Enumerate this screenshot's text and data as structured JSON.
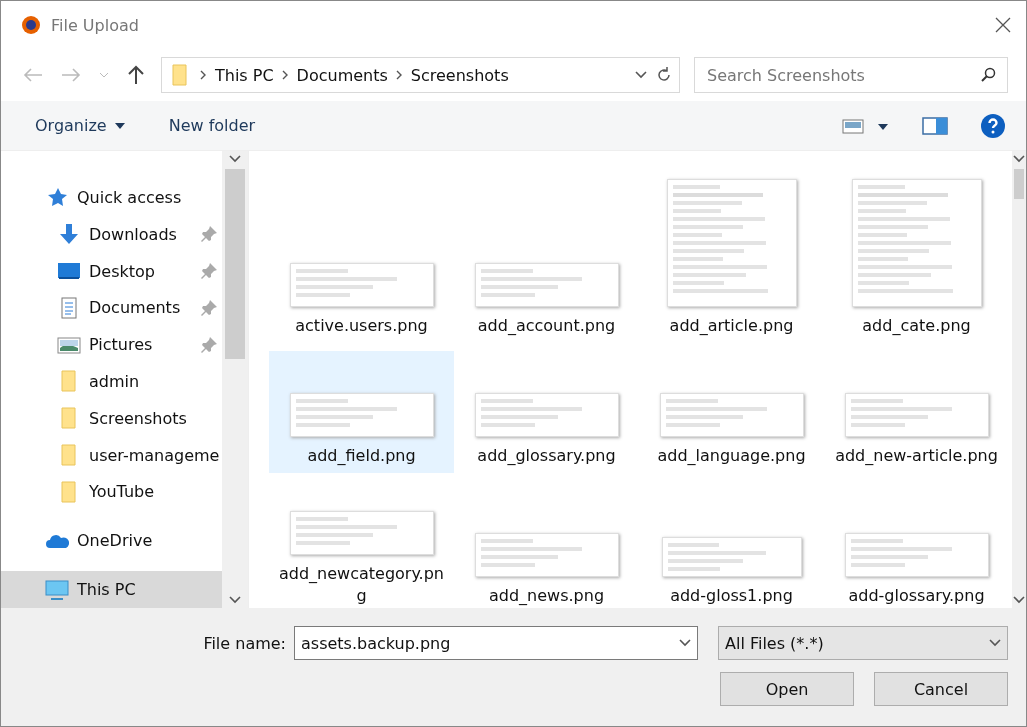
{
  "window": {
    "title": "File Upload"
  },
  "address": {
    "path": [
      "This PC",
      "Documents",
      "Screenshots"
    ],
    "search_placeholder": "Search Screenshots"
  },
  "toolbar": {
    "organize": "Organize",
    "new_folder": "New folder"
  },
  "sidebar": {
    "items": [
      {
        "kind": "header",
        "label": "Quick access",
        "pinned": false,
        "selected": false
      },
      {
        "kind": "item",
        "label": "Downloads",
        "pinned": true,
        "selected": false
      },
      {
        "kind": "item",
        "label": "Desktop",
        "pinned": true,
        "selected": false
      },
      {
        "kind": "item",
        "label": "Documents",
        "pinned": true,
        "selected": false
      },
      {
        "kind": "item",
        "label": "Pictures",
        "pinned": true,
        "selected": false
      },
      {
        "kind": "item",
        "label": "admin",
        "pinned": false,
        "selected": false
      },
      {
        "kind": "item",
        "label": "Screenshots",
        "pinned": false,
        "selected": false
      },
      {
        "kind": "item",
        "label": "user-manageme",
        "pinned": false,
        "selected": false
      },
      {
        "kind": "item",
        "label": "YouTube",
        "pinned": false,
        "selected": false
      },
      {
        "kind": "header",
        "label": "OneDrive",
        "pinned": false,
        "selected": false
      },
      {
        "kind": "header",
        "label": "This PC",
        "pinned": false,
        "selected": true
      }
    ]
  },
  "files": [
    {
      "name": "active.users.png",
      "selected": false
    },
    {
      "name": "add_account.png",
      "selected": false
    },
    {
      "name": "add_article.png",
      "selected": false
    },
    {
      "name": "add_cate.png",
      "selected": false
    },
    {
      "name": "add_field.png",
      "selected": true
    },
    {
      "name": "add_glossary.png",
      "selected": false
    },
    {
      "name": "add_language.png",
      "selected": false
    },
    {
      "name": "add_new-article.png",
      "selected": false
    },
    {
      "name": "add_newcategory.png",
      "selected": false
    },
    {
      "name": "add_news.png",
      "selected": false
    },
    {
      "name": "add-gloss1.png",
      "selected": false
    },
    {
      "name": "add-glossary.png",
      "selected": false
    }
  ],
  "footer": {
    "file_name_label": "File name:",
    "file_name": "assets.backup.png",
    "filter": "All Files (*.*)",
    "open": "Open",
    "cancel": "Cancel"
  }
}
